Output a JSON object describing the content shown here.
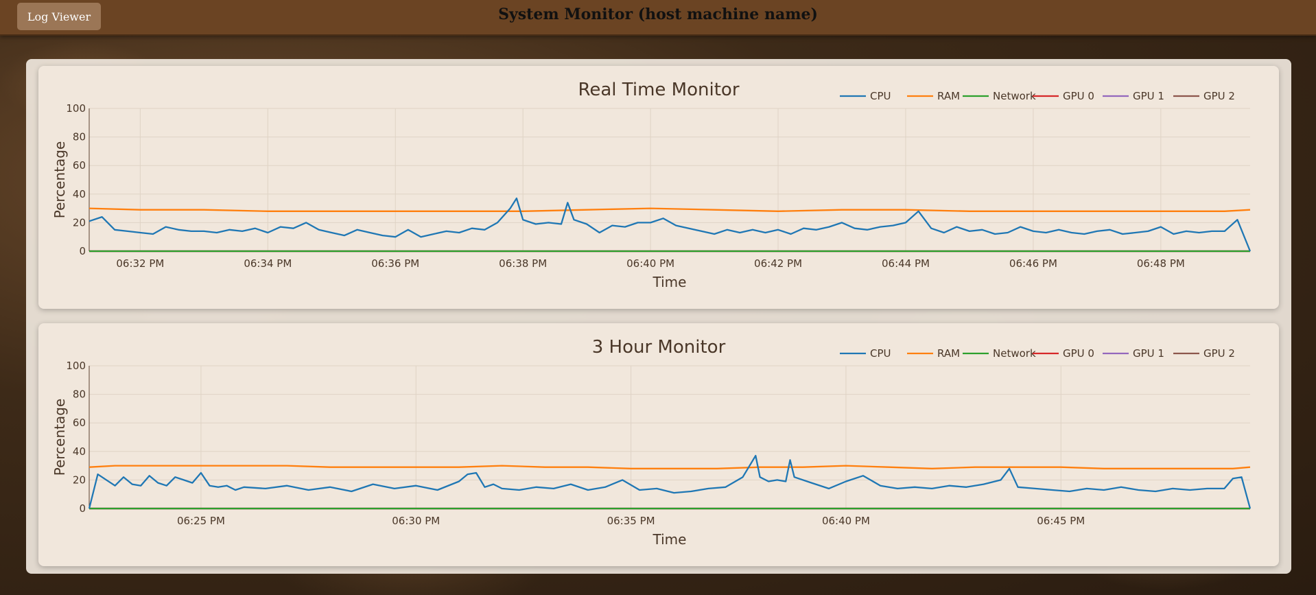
{
  "header": {
    "title": "System Monitor (host machine name)",
    "log_viewer_label": "Log Viewer"
  },
  "colors": {
    "CPU": "#1f77b4",
    "RAM": "#ff7f0e",
    "Network": "#2ca02c",
    "GPU 0": "#d62728",
    "GPU 1": "#9467bd",
    "GPU 2": "#8c564b"
  },
  "chart_data": [
    {
      "type": "line",
      "title": "Real Time Monitor",
      "xlabel": "Time",
      "ylabel": "Percentage",
      "ylim": [
        0,
        100
      ],
      "yticks": [
        0,
        20,
        40,
        60,
        80,
        100
      ],
      "xlim_minutes": [
        31.2,
        49.4
      ],
      "xticks": [
        {
          "minute": 32,
          "label": "06:32 PM"
        },
        {
          "minute": 34,
          "label": "06:34 PM"
        },
        {
          "minute": 36,
          "label": "06:36 PM"
        },
        {
          "minute": 38,
          "label": "06:38 PM"
        },
        {
          "minute": 40,
          "label": "06:40 PM"
        },
        {
          "minute": 42,
          "label": "06:42 PM"
        },
        {
          "minute": 44,
          "label": "06:44 PM"
        },
        {
          "minute": 46,
          "label": "06:46 PM"
        },
        {
          "minute": 48,
          "label": "06:48 PM"
        }
      ],
      "grid": true,
      "legend": "top-right",
      "series": [
        {
          "name": "CPU",
          "x_minutes": [
            31.2,
            31.4,
            31.6,
            31.8,
            32.0,
            32.2,
            32.4,
            32.6,
            32.8,
            33.0,
            33.2,
            33.4,
            33.6,
            33.8,
            34.0,
            34.2,
            34.4,
            34.6,
            34.8,
            35.0,
            35.2,
            35.4,
            35.6,
            35.8,
            36.0,
            36.2,
            36.4,
            36.6,
            36.8,
            37.0,
            37.2,
            37.4,
            37.6,
            37.8,
            37.9,
            38.0,
            38.2,
            38.4,
            38.6,
            38.7,
            38.8,
            39.0,
            39.2,
            39.4,
            39.6,
            39.8,
            40.0,
            40.2,
            40.4,
            40.6,
            40.8,
            41.0,
            41.2,
            41.4,
            41.6,
            41.8,
            42.0,
            42.2,
            42.4,
            42.6,
            42.8,
            43.0,
            43.2,
            43.4,
            43.6,
            43.8,
            44.0,
            44.2,
            44.4,
            44.6,
            44.8,
            45.0,
            45.2,
            45.4,
            45.6,
            45.8,
            46.0,
            46.2,
            46.4,
            46.6,
            46.8,
            47.0,
            47.2,
            47.4,
            47.6,
            47.8,
            48.0,
            48.2,
            48.4,
            48.6,
            48.8,
            49.0,
            49.2,
            49.4
          ],
          "values": [
            21,
            24,
            15,
            14,
            13,
            12,
            17,
            15,
            14,
            14,
            13,
            15,
            14,
            16,
            13,
            17,
            16,
            20,
            15,
            13,
            11,
            15,
            13,
            11,
            10,
            15,
            10,
            12,
            14,
            13,
            16,
            15,
            20,
            30,
            37,
            22,
            19,
            20,
            19,
            34,
            22,
            19,
            13,
            18,
            17,
            20,
            20,
            23,
            18,
            16,
            14,
            12,
            15,
            13,
            15,
            13,
            15,
            12,
            16,
            15,
            17,
            20,
            16,
            15,
            17,
            18,
            20,
            28,
            16,
            13,
            17,
            14,
            15,
            12,
            13,
            17,
            14,
            13,
            15,
            13,
            12,
            14,
            15,
            12,
            13,
            14,
            17,
            12,
            14,
            13,
            14,
            14,
            22,
            0
          ]
        },
        {
          "name": "RAM",
          "x_minutes": [
            31.2,
            32.0,
            33.0,
            34.0,
            35.0,
            36.0,
            37.0,
            38.0,
            39.0,
            40.0,
            41.0,
            42.0,
            43.0,
            44.0,
            45.0,
            46.0,
            47.0,
            48.0,
            49.0,
            49.4
          ],
          "values": [
            30,
            29,
            29,
            28,
            28,
            28,
            28,
            28,
            29,
            30,
            29,
            28,
            29,
            29,
            28,
            28,
            28,
            28,
            28,
            29
          ]
        },
        {
          "name": "Network",
          "x_minutes": [
            31.2,
            49.4
          ],
          "values": [
            0,
            0
          ]
        },
        {
          "name": "GPU 0",
          "x_minutes": [
            31.2,
            49.4
          ],
          "values": [
            0,
            0
          ]
        },
        {
          "name": "GPU 1",
          "x_minutes": [
            31.2,
            49.4
          ],
          "values": [
            0,
            0
          ]
        },
        {
          "name": "GPU 2",
          "x_minutes": [
            31.2,
            49.4
          ],
          "values": [
            0,
            0
          ]
        }
      ]
    },
    {
      "type": "line",
      "title": "3 Hour Monitor",
      "xlabel": "Time",
      "ylabel": "Percentage",
      "ylim": [
        0,
        100
      ],
      "yticks": [
        0,
        20,
        40,
        60,
        80,
        100
      ],
      "xlim_minutes": [
        22.4,
        49.4
      ],
      "xticks": [
        {
          "minute": 25,
          "label": "06:25 PM"
        },
        {
          "minute": 30,
          "label": "06:30 PM"
        },
        {
          "minute": 35,
          "label": "06:35 PM"
        },
        {
          "minute": 40,
          "label": "06:40 PM"
        },
        {
          "minute": 45,
          "label": "06:45 PM"
        }
      ],
      "grid": true,
      "legend": "top-right",
      "series": [
        {
          "name": "CPU",
          "x_minutes": [
            22.4,
            22.6,
            22.8,
            23.0,
            23.2,
            23.4,
            23.6,
            23.8,
            24.0,
            24.2,
            24.4,
            24.6,
            24.8,
            25.0,
            25.2,
            25.4,
            25.6,
            25.8,
            26.0,
            26.5,
            27.0,
            27.5,
            28.0,
            28.5,
            29.0,
            29.5,
            30.0,
            30.5,
            31.0,
            31.2,
            31.4,
            31.6,
            31.8,
            32.0,
            32.4,
            32.8,
            33.2,
            33.6,
            34.0,
            34.4,
            34.8,
            35.2,
            35.6,
            36.0,
            36.4,
            36.8,
            37.2,
            37.6,
            37.9,
            38.0,
            38.2,
            38.4,
            38.6,
            38.7,
            38.8,
            39.2,
            39.6,
            40.0,
            40.4,
            40.8,
            41.2,
            41.6,
            42.0,
            42.4,
            42.8,
            43.2,
            43.6,
            43.8,
            44.0,
            44.4,
            44.8,
            45.2,
            45.6,
            46.0,
            46.4,
            46.8,
            47.2,
            47.6,
            48.0,
            48.4,
            48.8,
            49.0,
            49.2,
            49.4
          ],
          "values": [
            0,
            24,
            20,
            16,
            22,
            17,
            16,
            23,
            18,
            16,
            22,
            20,
            18,
            25,
            16,
            15,
            16,
            13,
            15,
            14,
            16,
            13,
            15,
            12,
            17,
            14,
            16,
            13,
            19,
            24,
            25,
            15,
            17,
            14,
            13,
            15,
            14,
            17,
            13,
            15,
            20,
            13,
            14,
            11,
            12,
            14,
            15,
            22,
            37,
            22,
            19,
            20,
            19,
            34,
            22,
            18,
            14,
            19,
            23,
            16,
            14,
            15,
            14,
            16,
            15,
            17,
            20,
            28,
            15,
            14,
            13,
            12,
            14,
            13,
            15,
            13,
            12,
            14,
            13,
            14,
            14,
            21,
            22,
            0
          ]
        },
        {
          "name": "RAM",
          "x_minutes": [
            22.4,
            23.0,
            24.0,
            25.0,
            26.0,
            27.0,
            28.0,
            29.0,
            30.0,
            31.0,
            32.0,
            33.0,
            34.0,
            35.0,
            36.0,
            37.0,
            38.0,
            39.0,
            40.0,
            41.0,
            42.0,
            43.0,
            44.0,
            45.0,
            46.0,
            47.0,
            48.0,
            49.0,
            49.4
          ],
          "values": [
            29,
            30,
            30,
            30,
            30,
            30,
            29,
            29,
            29,
            29,
            30,
            29,
            29,
            28,
            28,
            28,
            29,
            29,
            30,
            29,
            28,
            29,
            29,
            29,
            28,
            28,
            28,
            28,
            29
          ]
        },
        {
          "name": "Network",
          "x_minutes": [
            22.4,
            49.4
          ],
          "values": [
            0,
            0
          ]
        },
        {
          "name": "GPU 0",
          "x_minutes": [
            22.4,
            49.4
          ],
          "values": [
            0,
            0
          ]
        },
        {
          "name": "GPU 1",
          "x_minutes": [
            22.4,
            49.4
          ],
          "values": [
            0,
            0
          ]
        },
        {
          "name": "GPU 2",
          "x_minutes": [
            22.4,
            49.4
          ],
          "values": [
            0,
            0
          ]
        }
      ]
    }
  ]
}
